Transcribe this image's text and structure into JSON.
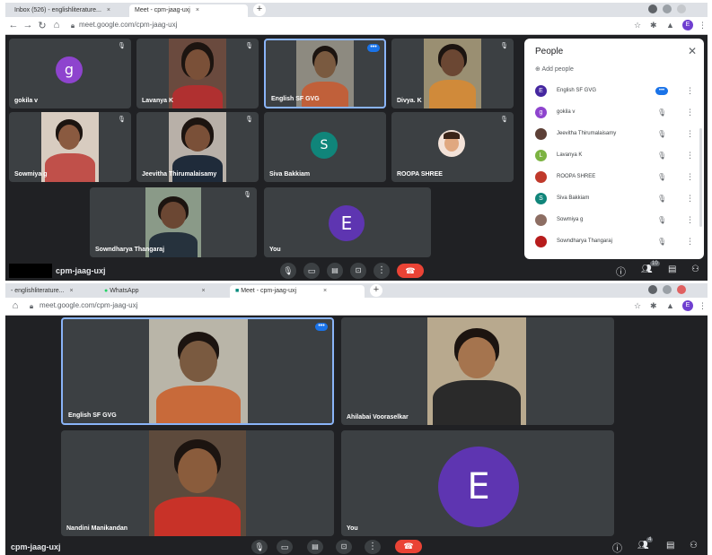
{
  "top": {
    "tabs": [
      {
        "label": "Inbox (526) - englishliterature..."
      },
      {
        "label": "Meet - cpm-jaag-uxj"
      }
    ],
    "url": "meet.google.com/cpm-jaag-uxj",
    "profile_initial": "E",
    "tiles": [
      {
        "name": "gokila v",
        "initial": "g",
        "color": "#8e44ce"
      },
      {
        "name": "Lavanya K"
      },
      {
        "name": "English SF GVG"
      },
      {
        "name": "Divya. K"
      },
      {
        "name": "Sowmiya g"
      },
      {
        "name": "Jeevitha Thirumalaisamy"
      },
      {
        "name": "Siva Bakkiam",
        "initial": "S",
        "color": "#10857a"
      },
      {
        "name": "ROOPA SHREE"
      },
      {
        "name": "Sowndharya Thangaraj"
      },
      {
        "name": "You",
        "initial": "E",
        "color": "#5e35b1"
      }
    ],
    "meeting_code": "cpm-jaag-uxj",
    "participant_count": "10",
    "people_panel": {
      "title": "People",
      "add_people": "Add people",
      "participants": [
        {
          "name": "English SF GVG",
          "initial": "E",
          "color": "#4527a0"
        },
        {
          "name": "gokila v",
          "initial": "g",
          "color": "#8e44ce"
        },
        {
          "name": "Jeevitha Thirumalaisamy",
          "initial": "",
          "color": "#5d4037"
        },
        {
          "name": "Lavanya K",
          "initial": "L",
          "color": "#7cb342"
        },
        {
          "name": "ROOPA SHREE",
          "initial": "",
          "color": "#c0392b"
        },
        {
          "name": "Siva Bakkiam",
          "initial": "S",
          "color": "#10857a"
        },
        {
          "name": "Sowmiya g",
          "initial": "",
          "color": "#8d6e63"
        },
        {
          "name": "Sowndharya Thangaraj",
          "initial": "",
          "color": "#b71c1c"
        }
      ]
    }
  },
  "bottom": {
    "tabs": [
      {
        "label": "- englishliterature..."
      },
      {
        "label": "WhatsApp"
      },
      {
        "label": "Meet - cpm-jaag-uxj"
      }
    ],
    "url": "meet.google.com/cpm-jaag-uxj",
    "profile_initial": "E",
    "tiles": [
      {
        "name": "English SF GVG"
      },
      {
        "name": "Ahilabai Vooraselkar"
      },
      {
        "name": "Nandini Manikandan"
      },
      {
        "name": "You",
        "initial": "E",
        "color": "#5e35b1"
      }
    ],
    "meeting_code": "cpm-jaag-uxj",
    "participant_count": "4"
  }
}
